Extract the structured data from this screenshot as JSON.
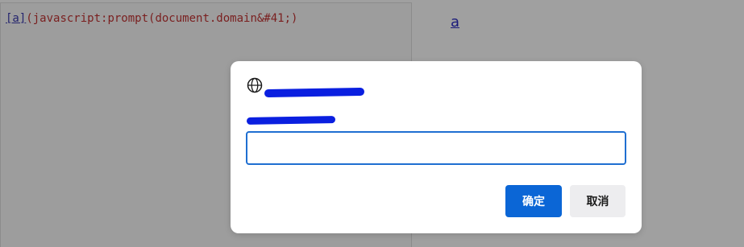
{
  "background_page": {
    "editor": {
      "link_text": "[a]",
      "trailing_text": "(javascript:prompt(document.domain&#41;)"
    },
    "preview": {
      "link_text": "a"
    }
  },
  "dialog": {
    "origin_text": "",
    "message": "",
    "input": {
      "value": "",
      "placeholder": ""
    },
    "ok_label": "确定",
    "cancel_label": "取消",
    "icons": {
      "origin_icon": "globe-icon"
    },
    "colors": {
      "ok_bg": "#0b66d6",
      "input_border": "#1f6fd1",
      "redaction": "#0a1fe0"
    }
  }
}
